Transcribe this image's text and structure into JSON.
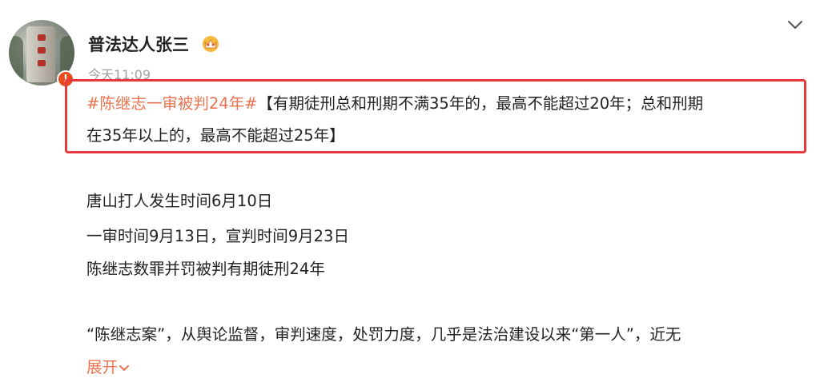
{
  "post": {
    "username": "普法达人张三",
    "timestamp": "今天11:09",
    "badge": "!",
    "hashtag": "#陈继志一审被判24年#",
    "highlight_rest": "【有期徒刑总和刑期不满35年的，最高不能超过20年；总和刑期",
    "highlight_line2": "在35年以上的，最高不能超过25年】",
    "body_lines": [
      "唐山打人发生时间6月10日",
      "一审时间9月13日，宣判时间9月23日",
      "陈继志数罪并罚被判有期徒刑24年"
    ],
    "paragraph": "“陈继志案”，从舆论监督，审判速度，处罚力度，几乎是法治建设以来“第一人”，近无",
    "expand_label": "展开"
  },
  "icons": {
    "vip": "vip-crown-icon",
    "menu": "chevron-down-icon",
    "expand": "expand-chevron-icon"
  },
  "colors": {
    "accent": "#eb7350",
    "highlight_border": "#e5393b",
    "muted": "#a0a0a0"
  }
}
